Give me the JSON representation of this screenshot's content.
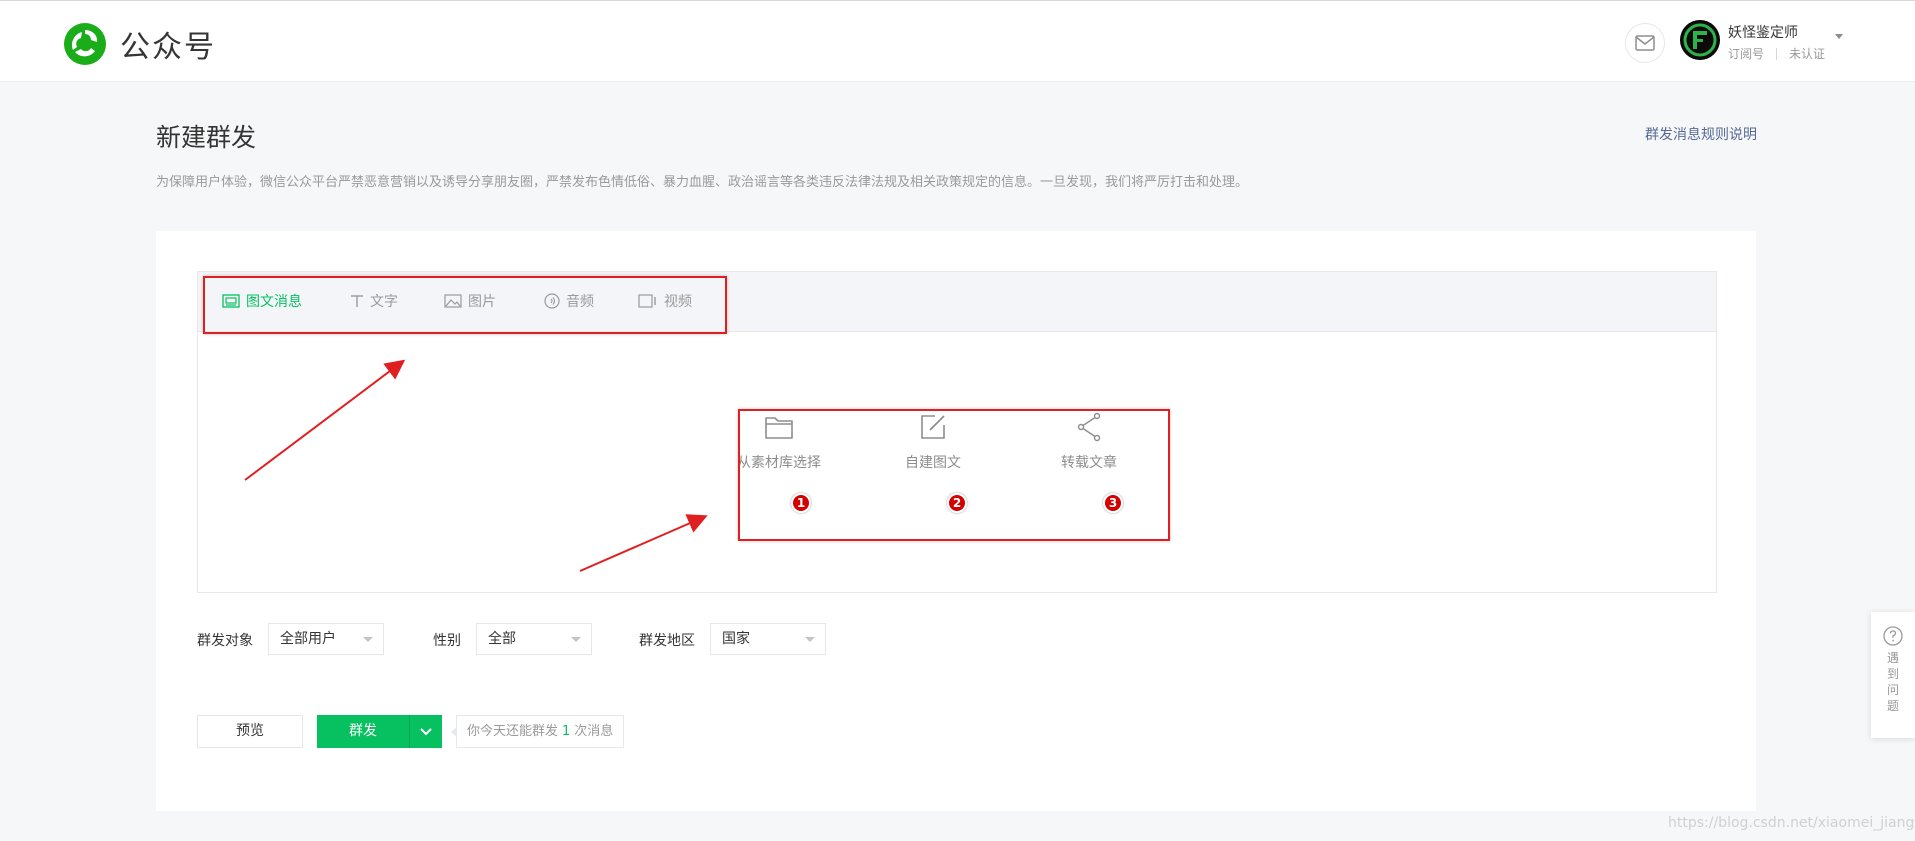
{
  "header": {
    "brand": "公众号",
    "account_name": "妖怪鉴定师",
    "account_type": "订阅号",
    "verify_status": "未认证"
  },
  "page": {
    "title": "新建群发",
    "rules_link": "群发消息规则说明",
    "notice": "为保障用户体验，微信公众平台严禁恶意营销以及诱导分享朋友圈，严禁发布色情低俗、暴力血腥、政治谣言等各类违反法律法规及相关政策规定的信息。一旦发现，我们将严厉打击和处理。"
  },
  "tabs": [
    {
      "label": "图文消息",
      "icon": "news-icon",
      "active": true
    },
    {
      "label": "文字",
      "icon": "text-icon",
      "active": false
    },
    {
      "label": "图片",
      "icon": "image-icon",
      "active": false
    },
    {
      "label": "音频",
      "icon": "audio-icon",
      "active": false
    },
    {
      "label": "视频",
      "icon": "video-icon",
      "active": false
    }
  ],
  "options": [
    {
      "label": "从素材库选择",
      "icon": "folder-icon",
      "badge": "1"
    },
    {
      "label": "自建图文",
      "icon": "edit-icon",
      "badge": "2"
    },
    {
      "label": "转载文章",
      "icon": "share-icon",
      "badge": "3"
    }
  ],
  "filters": {
    "target_label": "群发对象",
    "target_value": "全部用户",
    "gender_label": "性别",
    "gender_value": "全部",
    "region_label": "群发地区",
    "region_value": "国家"
  },
  "actions": {
    "preview": "预览",
    "send": "群发",
    "quota_prefix": "你今天还能群发",
    "quota_count": "1",
    "quota_suffix": "次消息"
  },
  "help": {
    "label": "遇到问题"
  },
  "watermark": "https://blog.csdn.net/xiaomei_jiang",
  "colors": {
    "brand_green": "#07c160",
    "link_blue": "#576b95",
    "annotation_red": "#e02020"
  }
}
